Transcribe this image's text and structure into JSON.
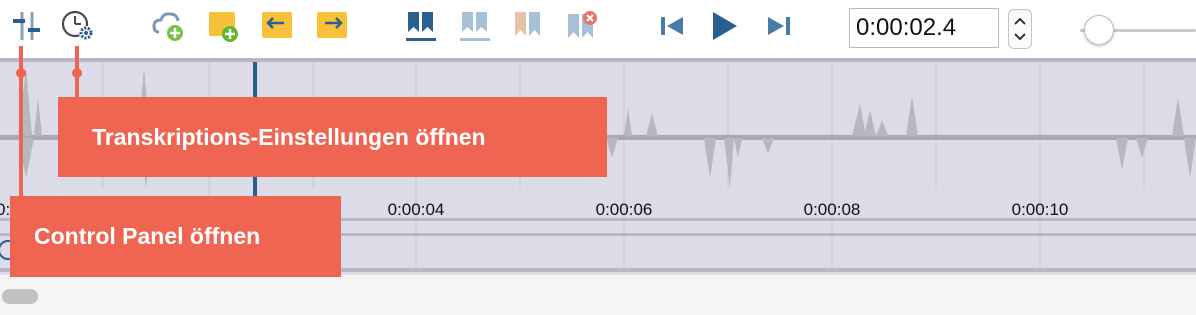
{
  "toolbar": {
    "icons": [
      {
        "name": "control-panel-icon"
      },
      {
        "name": "transcription-settings-icon"
      },
      {
        "name": "add-media-icon"
      },
      {
        "name": "new-document-icon"
      },
      {
        "name": "import-icon"
      },
      {
        "name": "export-icon"
      },
      {
        "name": "set-marker-icon"
      },
      {
        "name": "set-marker-disabled-icon"
      },
      {
        "name": "marker-range-icon"
      },
      {
        "name": "delete-marker-icon"
      },
      {
        "name": "skip-back-icon"
      },
      {
        "name": "play-icon"
      },
      {
        "name": "skip-forward-icon"
      }
    ],
    "time_value": "0:00:02.4",
    "volume_level": 0.05
  },
  "timeline": {
    "edge_tick": "0:",
    "ticks": [
      "0:00:04",
      "0:00:06",
      "0:00:08",
      "0:00:10"
    ]
  },
  "callouts": {
    "settings": "Transkriptions-Einstellungen öffnen",
    "control_panel": "Control Panel öffnen"
  },
  "colors": {
    "accent": "#2b5f8f",
    "accent_light": "#a7c0d8",
    "callout": "#f06552",
    "timeline_bg": "#dcdce8",
    "waveform": "#b7b7c0"
  }
}
